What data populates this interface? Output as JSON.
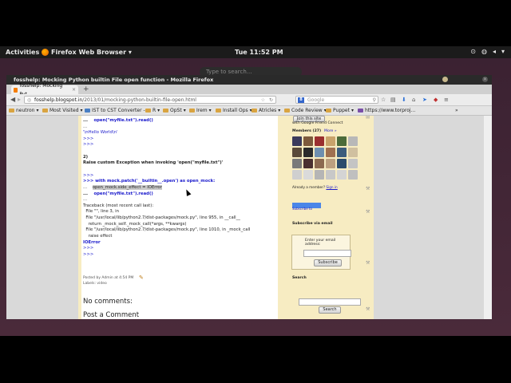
{
  "topbar": {
    "activities": "Activities",
    "app_menu": "Firefox Web Browser ▾",
    "clock": "Tue 11:52 PM"
  },
  "overview": {
    "search_placeholder": "Type to search..."
  },
  "window": {
    "title": "fosshelp: Mocking Python builtin File open function - Mozilla Firefox",
    "tab_label": "fosshelp: Mocking Pyt...",
    "url_domain": "fosshelp.blogspot.in",
    "url_path": "/2013/01/mocking-python-builtin-file-open.html",
    "search_engine": "Google"
  },
  "bookmarks": [
    {
      "label": "neutron"
    },
    {
      "label": "Most Visited"
    },
    {
      "label": "IST to CST Converter -..."
    },
    {
      "label": "R"
    },
    {
      "label": "OpSt"
    },
    {
      "label": "Irem"
    },
    {
      "label": "Install Ops"
    },
    {
      "label": "Atricles"
    },
    {
      "label": "Code Review"
    },
    {
      "label": "Puppet"
    },
    {
      "label": "https://www.torproj..."
    }
  ],
  "post": {
    "line1_prefix": "...",
    "line1_code": "open(\"myfile.txt\").read()",
    "line2": "...",
    "output1": "'\\nHello World\\n'",
    "prompt1": ">>>",
    "prompt2": ">>>",
    "heading_num": "2)",
    "heading": "Raise custom Exception when invoking 'open(\"myfile.txt\")'",
    "prompt3": ">>>",
    "with_line": ">>> with mock.patch('__builtin__.open') as open_mock:",
    "side_effect_prefix": "...",
    "side_effect": "open_mock.side_effect = IOError",
    "open_prefix": "...",
    "open_line": "open(\"myfile.txt\").read()",
    "dots": "...",
    "tb0": "Traceback (most recent call last):",
    "tb1": "  File \"\", line 3, in",
    "tb2": "  File \"/usr/local/lib/python2.7/dist-packages/mock.py\", line 955, in __call__",
    "tb3": "    return _mock_self._mock_call(*args, **kwargs)",
    "tb4": "  File \"/usr/local/lib/python2.7/dist-packages/mock.py\", line 1010, in _mock_call",
    "tb5": "    raise effect",
    "ioerror": "IOError",
    "prompt4": ">>>",
    "prompt5": ">>>",
    "posted_by": "Posted by Admin at 4:54 PM",
    "labels": "Labels: video",
    "no_comments": "No comments:",
    "post_comment": "Post a Comment"
  },
  "sidebar": {
    "join_button": "Join this site",
    "gfc": "with Google Friend Connect",
    "members": "Members (27)",
    "more": "More »",
    "already_member": "Already a member?",
    "sign_in": "Sign in",
    "subscribe_link": "Subscribe to",
    "subscribe_email": "Subscribe via email",
    "enter_email": "Enter your email address:",
    "subscribe_button": "Subscribe",
    "search_heading": "Search",
    "search_button": "Search"
  },
  "colors": {
    "page_bg": "#f7ecc2",
    "link_blue": "#1a1acc",
    "desktop": "#3b2232"
  },
  "member_faces": [
    "#3a3a5c",
    "#7d5a3c",
    "#9a2f2f",
    "#c9a36b",
    "#4b6b3a",
    "#b8b8b8",
    "#5a4a3a",
    "#2b2b2b",
    "#6e8fb0",
    "#a07050",
    "#3c5c7c",
    "#d0c0a0",
    "#7a7a7a",
    "#4a3030",
    "#8c6a50",
    "#bca080",
    "#2c4c6c",
    "#c4c4c4",
    "#cfcfcf",
    "#dadada",
    "#b5b5b5",
    "#c8c8c8",
    "#d4d4d4",
    "#bfbfbf"
  ]
}
